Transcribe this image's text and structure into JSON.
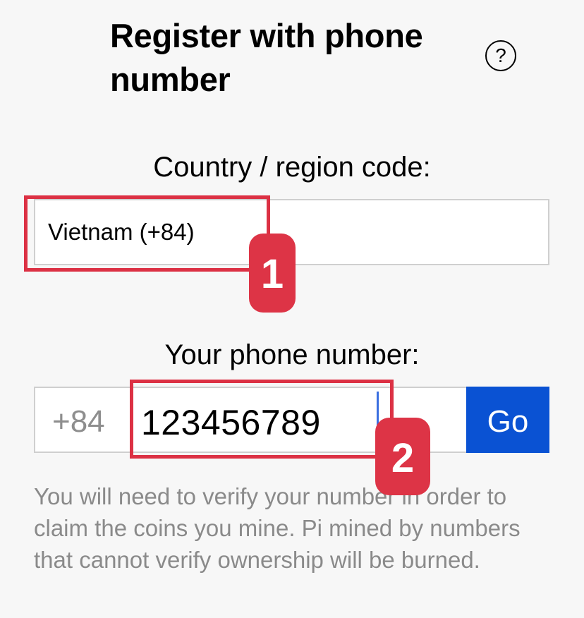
{
  "header": {
    "title": "Register with phone number",
    "help_icon": "question-mark-circle-icon",
    "help_glyph": "?"
  },
  "country": {
    "label": "Country / region code:",
    "selected_value": "Vietnam (+84)"
  },
  "phone": {
    "label": "Your phone number:",
    "prefix": "+84",
    "value": "123456789",
    "go_label": "Go"
  },
  "notice": "You will need to verify your number in order to claim the coins you mine. Pi mined by numbers that cannot verify ownership will be burned.",
  "annotations": {
    "step_1": "1",
    "step_2": "2"
  },
  "colors": {
    "background": "#f7f7f7",
    "go_button": "#0a52d3",
    "annotation_red": "#dc3144",
    "muted_text": "#8a8a8a",
    "caret": "#3a6fe0"
  }
}
